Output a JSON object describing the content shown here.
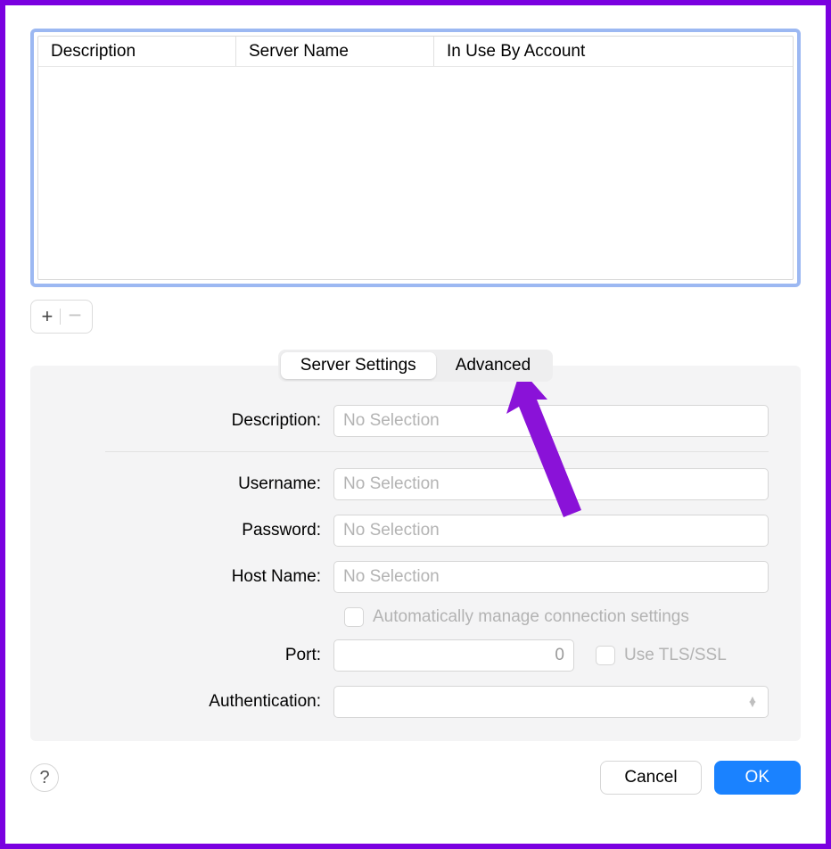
{
  "table": {
    "columns": {
      "description": "Description",
      "server_name": "Server Name",
      "in_use": "In Use By Account"
    }
  },
  "tabs": {
    "server_settings": "Server Settings",
    "advanced": "Advanced"
  },
  "form": {
    "description_label": "Description:",
    "description_placeholder": "No Selection",
    "username_label": "Username:",
    "username_placeholder": "No Selection",
    "password_label": "Password:",
    "password_placeholder": "No Selection",
    "hostname_label": "Host Name:",
    "hostname_placeholder": "No Selection",
    "auto_manage_label": "Automatically manage connection settings",
    "port_label": "Port:",
    "port_value": "0",
    "tls_label": "Use TLS/SSL",
    "auth_label": "Authentication:"
  },
  "buttons": {
    "help": "?",
    "cancel": "Cancel",
    "ok": "OK",
    "plus": "+",
    "minus": "−"
  }
}
